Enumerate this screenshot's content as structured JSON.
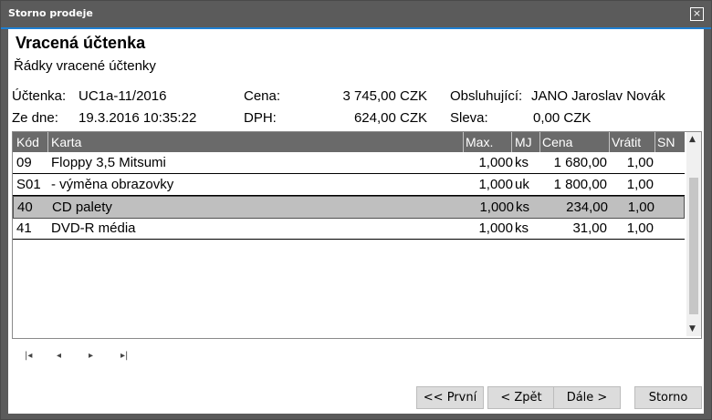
{
  "window": {
    "title": "Storno prodeje",
    "close_icon": "×"
  },
  "heading": {
    "title": "Vracená účtenka",
    "subtitle": "Řádky vracené účtenky"
  },
  "info": {
    "uctenka_label": "Účtenka:",
    "uctenka_value": "UC1a-11/2016",
    "datum_label": "Ze dne:",
    "datum_value": "19.3.2016 10:35:22",
    "cena_label": "Cena:",
    "cena_value": "3 745,00 CZK",
    "dph_label": "DPH:",
    "dph_value": "624,00 CZK",
    "obsluhujici_label": "Obsluhující:",
    "obsluhujici_value": "JANO Jaroslav Novák",
    "sleva_label": "Sleva:",
    "sleva_value": "0,00 CZK"
  },
  "grid": {
    "columns": [
      "Kód",
      "Karta",
      "Max.",
      "MJ",
      "Cena",
      "Vrátit",
      "SN"
    ],
    "rows": [
      {
        "kod": "09",
        "karta": "Floppy 3,5 Mitsumi",
        "max": "1,000",
        "mj": "ks",
        "cena": "1 680,00",
        "vratit": "1,00"
      },
      {
        "kod": "S01",
        "karta": "- výměna obrazovky",
        "max": "1,000",
        "mj": "uk",
        "cena": "1 800,00",
        "vratit": "1,00"
      },
      {
        "kod": "40",
        "karta": "CD palety",
        "max": "1,000",
        "mj": "ks",
        "cena": "234,00",
        "vratit": "1,00"
      },
      {
        "kod": "41",
        "karta": "DVD-R média",
        "max": "1,000",
        "mj": "ks",
        "cena": "31,00",
        "vratit": "1,00"
      }
    ],
    "selected_row": 2
  },
  "nav": {
    "first": "|◂",
    "prev": "◂",
    "next": "▸",
    "last": "▸|"
  },
  "buttons": {
    "prvni": "<< První",
    "zpet": "< Zpět",
    "dale": "Dále >",
    "storno": "Storno"
  }
}
